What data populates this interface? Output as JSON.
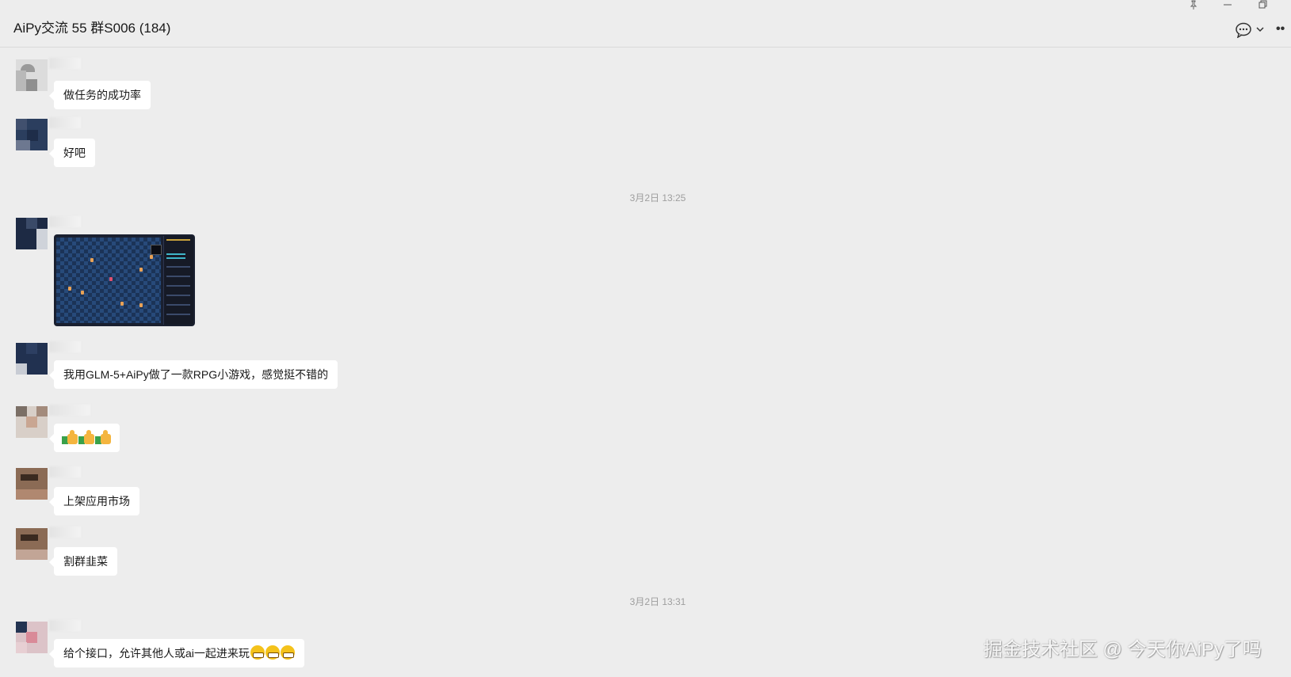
{
  "window": {
    "title": "AiPy交流 55 群S006 (184)",
    "controls": {
      "pin": "pin-icon",
      "minimize": "minimize-icon",
      "restore": "restore-icon"
    },
    "actions": {
      "chat": "chat-bubble-icon",
      "dropdown": "chevron-down-icon",
      "more": "more-icon"
    }
  },
  "messages": [
    {
      "type": "text",
      "text": "做任务的成功率"
    },
    {
      "type": "text",
      "text": "好吧"
    },
    {
      "type": "timestamp",
      "text": "3月2日 13:25"
    },
    {
      "type": "image",
      "description_icon": "game-screenshot"
    },
    {
      "type": "text",
      "text": "我用GLM-5+AiPy做了一款RPG小游戏，感觉挺不错的"
    },
    {
      "type": "emoji",
      "emojis": [
        "thumbs-up",
        "thumbs-up",
        "thumbs-up"
      ]
    },
    {
      "type": "text",
      "text": "上架应用市场"
    },
    {
      "type": "text",
      "text": "割群韭菜"
    },
    {
      "type": "timestamp",
      "text": "3月2日 13:31"
    },
    {
      "type": "text",
      "text": "给个接口，允许其他人或ai一起进来玩",
      "emojis": [
        "grin",
        "grin",
        "grin"
      ]
    }
  ],
  "watermark": "掘金技术社区 @ 今天你AiPy了吗",
  "colors": {
    "background": "#ededed",
    "bubble": "#ffffff",
    "timestamp": "#9e9e9e"
  }
}
